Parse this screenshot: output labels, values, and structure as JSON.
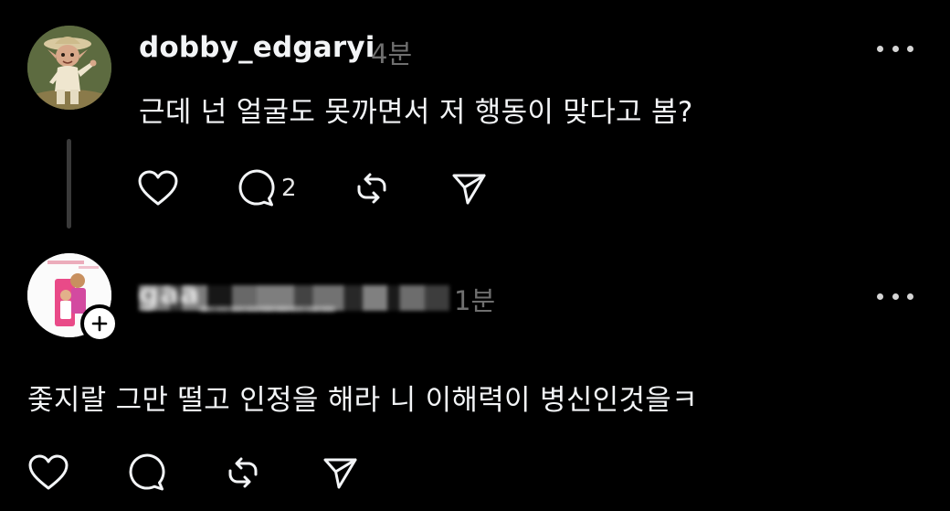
{
  "posts": [
    {
      "username": "dobby_edgaryi",
      "time": "4분",
      "text": "근데 넌 얼굴도 못까면서 저 행동이 맞다고 봄?",
      "reply_count": "2",
      "avatar": "elf-character-avatar"
    },
    {
      "username": "gaa_________",
      "time": "1분",
      "text": "좇지랄 그만 떨고 인정을 해라 니 이해력이 병신인것을ㅋ",
      "avatar": "profile-photo-avatar",
      "follow_badge": "plus-icon"
    }
  ],
  "icons": {
    "like": "heart-icon",
    "reply": "comment-icon",
    "repost": "repost-icon",
    "share": "send-icon",
    "more": "more-options-icon"
  },
  "colors": {
    "background": "#000000",
    "text_primary": "#f3f5f7",
    "text_secondary": "#6f6f6f",
    "thread_line": "#3a3a3a"
  }
}
